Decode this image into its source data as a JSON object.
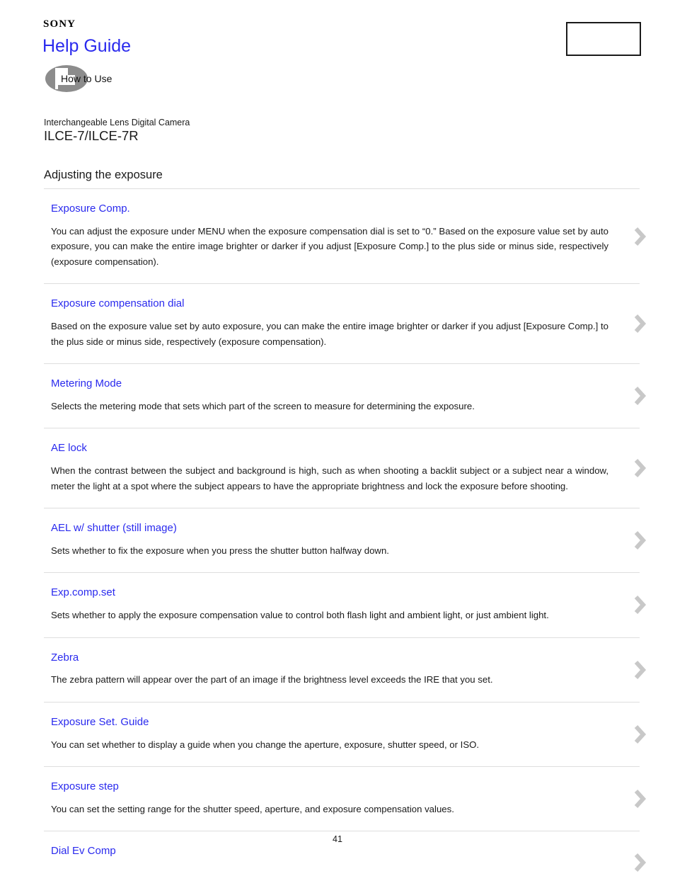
{
  "header": {
    "brand": "SONY",
    "title": "Help Guide",
    "how_to_use": "How to Use",
    "icon_names": {
      "brand": "sony-logo",
      "how_to_use": "how-to-use-icon",
      "box": "header-empty-box"
    }
  },
  "product": {
    "kind": "Interchangeable Lens Digital Camera",
    "model": "ILCE-7/ILCE-7R"
  },
  "section": {
    "title": "Adjusting the exposure"
  },
  "colors": {
    "link_blue": "#2a2aee",
    "text_black": "#1a1a1a",
    "divider_gray": "#dedede",
    "chevron_gray": "#c8c8c8",
    "icon_gray": "#8c8c8c"
  },
  "topics": [
    {
      "title": "Exposure Comp.",
      "description": "You can adjust the exposure under MENU when the exposure compensation dial is set to “0.” Based on the exposure value set by auto exposure, you can make the entire image brighter or darker if you adjust [Exposure Comp.] to the plus side or minus side, respectively (exposure compensation)."
    },
    {
      "title": "Exposure compensation dial",
      "description": "Based on the exposure value set by auto exposure, you can make the entire image brighter or darker if you adjust [Exposure Comp.] to the plus side or minus side, respectively (exposure compensation)."
    },
    {
      "title": "Metering Mode",
      "description": "Selects the metering mode that sets which part of the screen to measure for determining the exposure."
    },
    {
      "title": "AE lock",
      "description": "When the contrast between the subject and background is high, such as when shooting a backlit subject or a subject near a window, meter the light at a spot where the subject appears to have the appropriate brightness and lock the exposure before shooting."
    },
    {
      "title": "AEL w/ shutter (still image)",
      "description": "Sets whether to fix the exposure when you press the shutter button halfway down."
    },
    {
      "title": "Exp.comp.set",
      "description": "Sets whether to apply the exposure compensation value to control both flash light and ambient light, or just ambient light."
    },
    {
      "title": "Zebra",
      "description": "The zebra pattern will appear over the part of an image if the brightness level exceeds the IRE that you set."
    },
    {
      "title": "Exposure Set. Guide",
      "description": "You can set whether to display a guide when you change the aperture, exposure, shutter speed, or ISO."
    },
    {
      "title": "Exposure step",
      "description": "You can set the setting range for the shutter speed, aperture, and exposure compensation values."
    },
    {
      "title": "Dial Ev Comp",
      "description": ""
    }
  ],
  "footer": {
    "page_number": "41"
  }
}
